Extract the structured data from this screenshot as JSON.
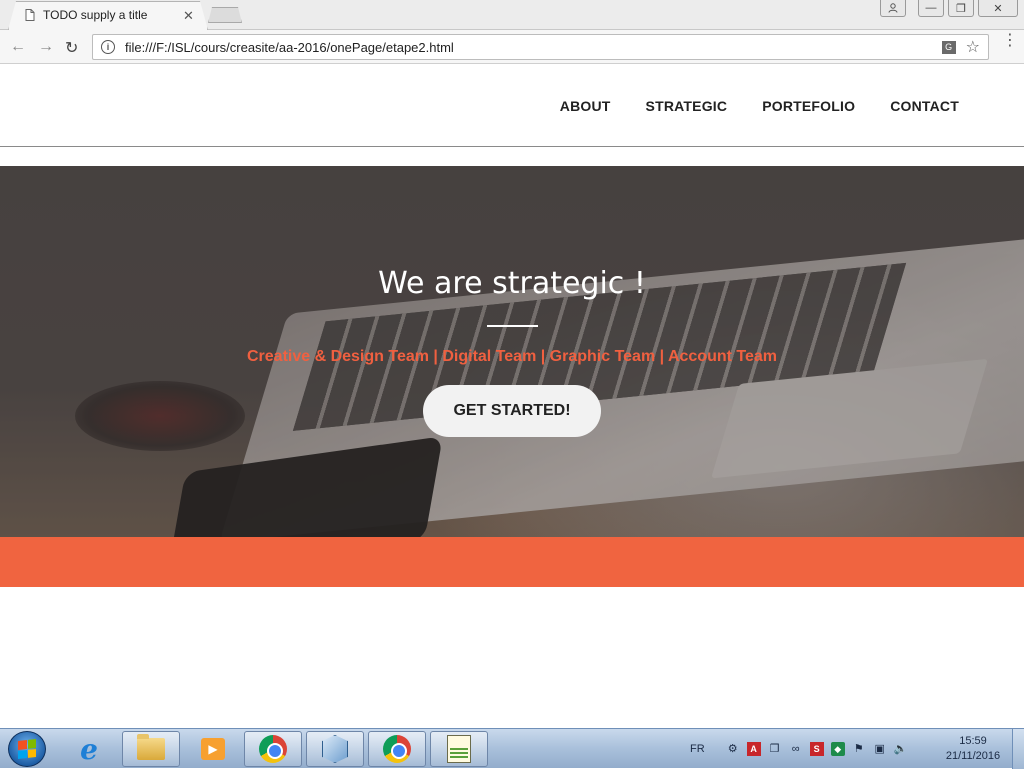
{
  "browser": {
    "tab_title": "TODO supply a title",
    "tab_close": "✕",
    "url": "file:///F:/ISL/cours/creasite/aa-2016/onePage/etape2.html",
    "window_controls": {
      "minimize": "—",
      "maximize": "❐",
      "close": "✕",
      "user": "👤"
    },
    "icons": {
      "back": "←",
      "forward": "→",
      "reload": "↻",
      "info": "i",
      "translate": "G",
      "bookmark": "☆",
      "menu": "⋮",
      "page": "page-icon"
    }
  },
  "site": {
    "nav": [
      "ABOUT",
      "STRATEGIC",
      "PORTEFOLIO",
      "CONTACT"
    ],
    "hero": {
      "title": "We are strategic !",
      "teams": "Creative & Design Team | Digital Team | Graphic Team | Account Team",
      "cta": "GET STARTED!"
    },
    "colors": {
      "accent": "#f06440",
      "teams_text": "#f06040",
      "hero_bg": "#4a4443"
    }
  },
  "taskbar": {
    "language": "FR",
    "time": "15:59",
    "date": "21/11/2016",
    "apps": [
      "start-button",
      "internet-explorer",
      "file-explorer",
      "media-player",
      "chrome",
      "virtualbox",
      "chrome",
      "notepad-plus-plus"
    ],
    "tray_icons": [
      "network-icon",
      "acrobat-icon",
      "copy-icon",
      "link-icon",
      "sw-icon",
      "shield-icon",
      "flag-icon",
      "display-icon",
      "volume-icon"
    ]
  }
}
